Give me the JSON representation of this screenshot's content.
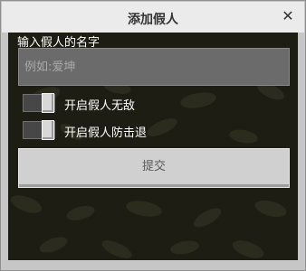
{
  "dialog": {
    "title": "添加假人",
    "close_icon": "close-icon",
    "close_glyph": "✕"
  },
  "form": {
    "name_label": "输入假人的名字",
    "name_value": "",
    "name_placeholder": "例如:爱坤",
    "toggles": [
      {
        "label": "开启假人无敌",
        "checked": true
      },
      {
        "label": "开启假人防击退",
        "checked": true
      }
    ],
    "submit_label": "提交"
  },
  "colors": {
    "background": "#1d1d14",
    "dialog_frame": "#c6c6c6",
    "titlebar": "#ebebeb"
  }
}
